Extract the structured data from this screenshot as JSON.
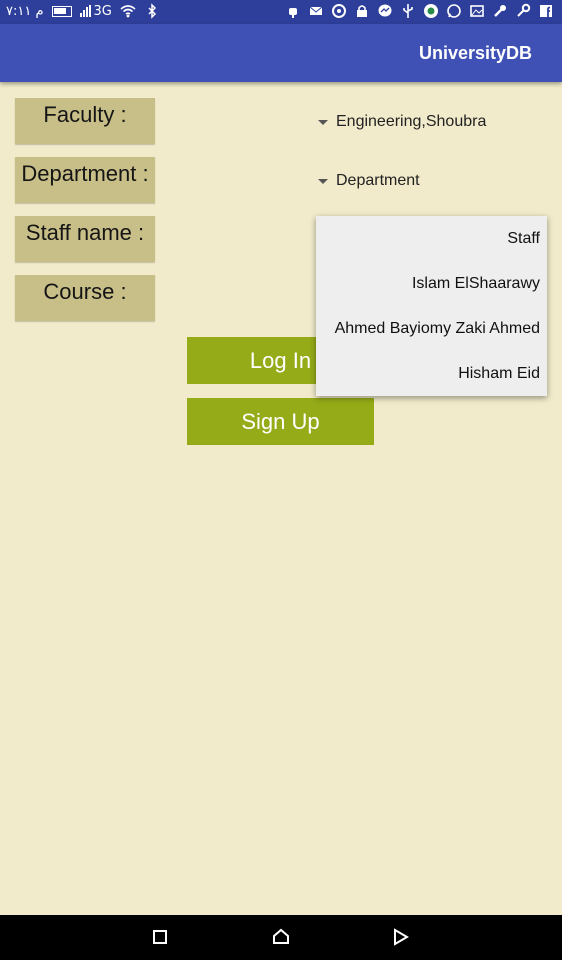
{
  "status_bar": {
    "time": "م ٧:١١",
    "network": "3G"
  },
  "app_bar": {
    "title": "UniversityDB"
  },
  "form": {
    "faculty_label": "Faculty :",
    "department_label": "Department :",
    "staff_label": "Staff name :",
    "course_label": "Course :",
    "faculty_value": "Engineering,Shoubra",
    "department_value": "Department"
  },
  "buttons": {
    "login": "Log In",
    "signup": "Sign Up"
  },
  "staff_dropdown": {
    "options": [
      "Staff",
      "Islam ElShaarawy",
      "Ahmed Bayiomy Zaki Ahmed",
      "Hisham Eid"
    ]
  },
  "colors": {
    "app_bar": "#3f51b5",
    "status_bar": "#2e3f9b",
    "background": "#f1ebcb",
    "label_box": "#c8bf88",
    "button": "#95ab17"
  }
}
